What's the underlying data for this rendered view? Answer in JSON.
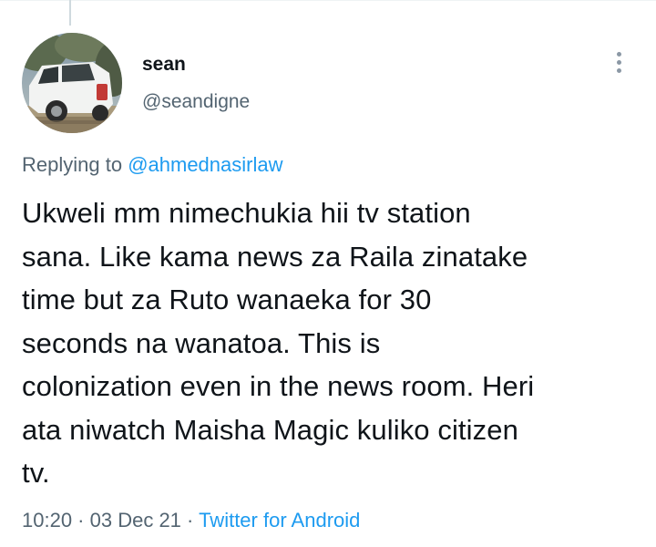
{
  "tweet": {
    "user": {
      "display_name": "sean",
      "handle": "@seandigne",
      "avatar_icon": "avatar-car-photo"
    },
    "replying_prefix": "Replying to ",
    "replying_to": "@ahmednasirlaw",
    "text": "Ukweli mm nimechukia hii tv station\nsana. Like kama news za Raila zinatake\ntime but za Ruto wanaeka for 30\nseconds na wanatoa. This is\ncolonization even in the news room. Heri\nata niwatch Maisha Magic kuliko citizen\ntv.",
    "time": "10:20",
    "separator_1": " · ",
    "date": "03 Dec 21",
    "separator_2": " · ",
    "source": "Twitter for Android",
    "more_icon": "more-vertical-icon"
  },
  "colors": {
    "text_primary": "#0f1419",
    "text_secondary": "#536471",
    "link": "#1d9bf0"
  }
}
